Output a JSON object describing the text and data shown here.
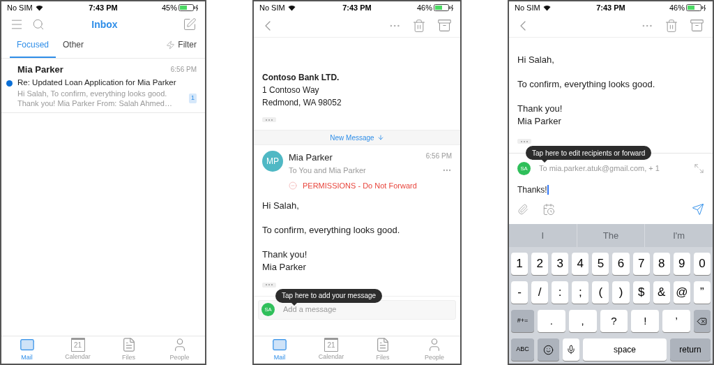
{
  "inbox_screen": {
    "status_bar": {
      "carrier": "No SIM",
      "time": "7:43 PM",
      "battery": "45%"
    },
    "title": "Inbox",
    "tabs": [
      {
        "label": "Focused",
        "selected": true
      },
      {
        "label": "Other",
        "selected": false
      }
    ],
    "filter": "Filter",
    "messages": [
      {
        "sender": "Mia Parker",
        "time": "6:56 PM",
        "subject": "Re: Updated Loan Application for Mia Parker",
        "preview_lines": [
          "Hi Salah, To confirm, everything looks good.",
          "Thank you! Mia Parker From: Salah Ahmed…"
        ],
        "unread": true,
        "count": "1"
      }
    ],
    "nav": [
      {
        "kind": "mail",
        "label": "Mail",
        "selected": true
      },
      {
        "kind": "calendar",
        "label": "Calendar",
        "day": "21",
        "selected": false
      },
      {
        "kind": "files",
        "label": "Files",
        "selected": false
      },
      {
        "kind": "people",
        "label": "People",
        "selected": false
      }
    ]
  },
  "message_screen": {
    "status_bar": {
      "carrier": "No SIM",
      "time": "7:43 PM",
      "battery": "46%"
    },
    "address_lines": [
      {
        "text": "Contoso Bank LTD.",
        "bold": true
      },
      {
        "text": "1 Contoso Way",
        "bold": false
      },
      {
        "text": "Redmond, WA 98052",
        "bold": false
      }
    ],
    "new_message": "New Message",
    "message": {
      "initials": "MP",
      "sender": "Mia Parker",
      "recipients": "To You and Mia Parker",
      "time": "6:56 PM",
      "permission": "PERMISSIONS - Do Not Forward",
      "body": [
        [
          "Hi Salah,"
        ],
        [
          "To confirm, everything looks good."
        ],
        [
          "Thank you!",
          "Mia Parker"
        ]
      ]
    },
    "tooltip": "Tap here to add your message",
    "composer": {
      "initials": "SA",
      "placeholder": "Add a message"
    },
    "nav": [
      {
        "kind": "mail",
        "label": "Mail",
        "selected": true
      },
      {
        "kind": "calendar",
        "label": "Calendar",
        "day": "21",
        "selected": false
      },
      {
        "kind": "files",
        "label": "Files",
        "selected": false
      },
      {
        "kind": "people",
        "label": "People",
        "selected": false
      }
    ]
  },
  "compose_screen": {
    "status_bar": {
      "carrier": "No SIM",
      "time": "7:43 PM",
      "battery": "46%"
    },
    "body": [
      [
        "Hi Salah,"
      ],
      [
        "To confirm, everything looks good."
      ],
      [
        "Thank you!",
        "Mia Parker"
      ]
    ],
    "tooltip": "Tap here to edit recipients or forward",
    "reply": {
      "initials": "SA",
      "recipients": "To mia.parker.atuk@gmail.com, + 1",
      "value": "Thanks!"
    },
    "suggestions": [
      "I",
      "The",
      "I'm"
    ],
    "keyboard": [
      [
        {
          "kind": "char",
          "label": "1"
        },
        {
          "kind": "char",
          "label": "2"
        },
        {
          "kind": "char",
          "label": "3"
        },
        {
          "kind": "char",
          "label": "4"
        },
        {
          "kind": "char",
          "label": "5"
        },
        {
          "kind": "char",
          "label": "6"
        },
        {
          "kind": "char",
          "label": "7"
        },
        {
          "kind": "char",
          "label": "8"
        },
        {
          "kind": "char",
          "label": "9"
        },
        {
          "kind": "char",
          "label": "0"
        }
      ],
      [
        {
          "kind": "char",
          "label": "-"
        },
        {
          "kind": "char",
          "label": "/"
        },
        {
          "kind": "char",
          "label": ":"
        },
        {
          "kind": "char",
          "label": ";"
        },
        {
          "kind": "char",
          "label": "("
        },
        {
          "kind": "char",
          "label": ")"
        },
        {
          "kind": "char",
          "label": "$"
        },
        {
          "kind": "char",
          "label": "&"
        },
        {
          "kind": "char",
          "label": "@"
        },
        {
          "kind": "char",
          "label": "”"
        }
      ],
      [
        {
          "kind": "function",
          "label": "#+="
        },
        {
          "kind": "wide",
          "label": "."
        },
        {
          "kind": "wide",
          "label": ","
        },
        {
          "kind": "wide",
          "label": "?"
        },
        {
          "kind": "wide",
          "label": "!"
        },
        {
          "kind": "wide",
          "label": "’"
        },
        {
          "kind": "backspace"
        }
      ],
      [
        {
          "kind": "function",
          "label": "ABC"
        },
        {
          "kind": "emoji"
        },
        {
          "kind": "mic"
        },
        {
          "kind": "space",
          "label": "space"
        },
        {
          "kind": "return",
          "label": "return"
        }
      ]
    ]
  }
}
